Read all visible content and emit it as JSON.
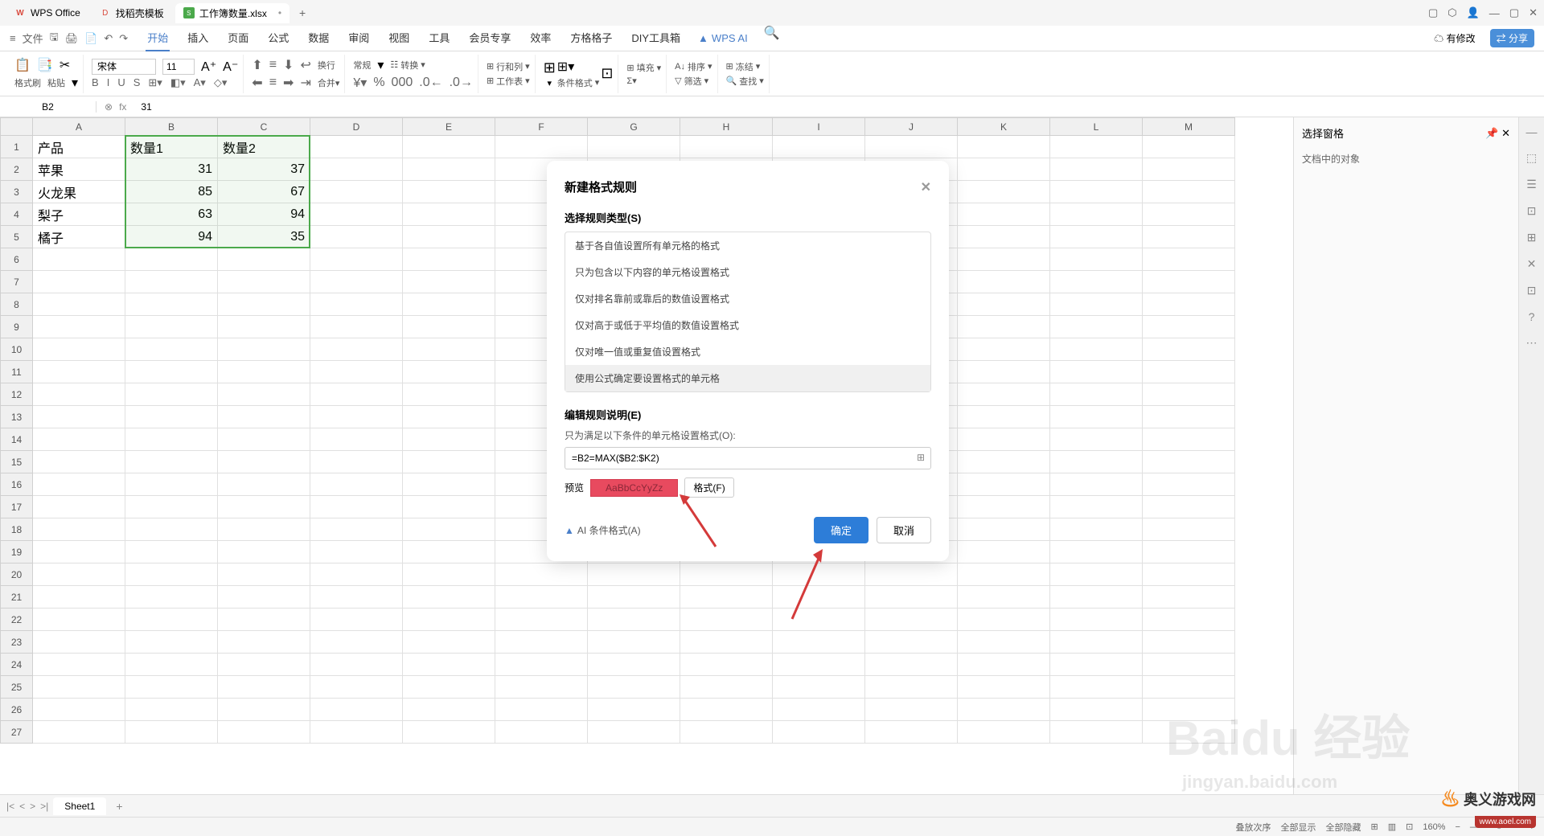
{
  "titlebar": {
    "tabs": [
      {
        "icon": "W",
        "label": "WPS Office"
      },
      {
        "icon": "D",
        "label": "找稻壳模板"
      },
      {
        "icon": "S",
        "label": "工作簿数量.xlsx"
      }
    ],
    "add": "+"
  },
  "menubar": {
    "file": "文件",
    "tabs": [
      "开始",
      "插入",
      "页面",
      "公式",
      "数据",
      "审阅",
      "视图",
      "工具",
      "会员专享",
      "效率",
      "方格格子",
      "DIY工具箱"
    ],
    "ai": "WPS AI",
    "modify": "有修改",
    "share": "分享"
  },
  "ribbon": {
    "format_painter": "格式刷",
    "paste": "粘贴",
    "font": "宋体",
    "size": "11",
    "general": "常规",
    "convert": "转换",
    "rowcol": "行和列",
    "worksheet": "工作表",
    "cond_format": "条件格式",
    "fill": "填充",
    "sort": "排序",
    "freeze": "冻结",
    "filter": "筛选",
    "find": "查找"
  },
  "formulabar": {
    "cell": "B2",
    "fx": "fx",
    "value": "31"
  },
  "grid": {
    "cols": [
      "A",
      "B",
      "C",
      "D",
      "E",
      "F",
      "G",
      "H",
      "I",
      "J",
      "K",
      "L",
      "M"
    ],
    "rows": 27,
    "data": [
      [
        "产品",
        "数量1",
        "数量2"
      ],
      [
        "苹果",
        "31",
        "37"
      ],
      [
        "火龙果",
        "85",
        "67"
      ],
      [
        "梨子",
        "63",
        "94"
      ],
      [
        "橘子",
        "94",
        "35"
      ]
    ]
  },
  "dialog": {
    "title": "新建格式规则",
    "section1": "选择规则类型(S)",
    "rules": [
      "基于各自值设置所有单元格的格式",
      "只为包含以下内容的单元格设置格式",
      "仅对排名靠前或靠后的数值设置格式",
      "仅对高于或低于平均值的数值设置格式",
      "仅对唯一值或重复值设置格式",
      "使用公式确定要设置格式的单元格"
    ],
    "section2": "编辑规则说明(E)",
    "desc": "只为满足以下条件的单元格设置格式(O):",
    "formula": "=B2=MAX($B2:$K2)",
    "preview_label": "预览",
    "preview_text": "AaBbCcYyZz",
    "format_btn": "格式(F)",
    "ai_format": "AI 条件格式(A)",
    "ok": "确定",
    "cancel": "取消"
  },
  "sidepanel": {
    "title": "选择窗格",
    "sub": "文档中的对象"
  },
  "sheets": {
    "name": "Sheet1"
  },
  "statusbar": {
    "stack": "叠放次序",
    "show_all": "全部显示",
    "hide_all": "全部隐藏",
    "zoom": "160%"
  },
  "watermark": {
    "main": "Baidu 经验",
    "sub": "jingyan.baidu.com",
    "logo": "奥义游戏网",
    "logo_sub": "www.aoel.com"
  }
}
